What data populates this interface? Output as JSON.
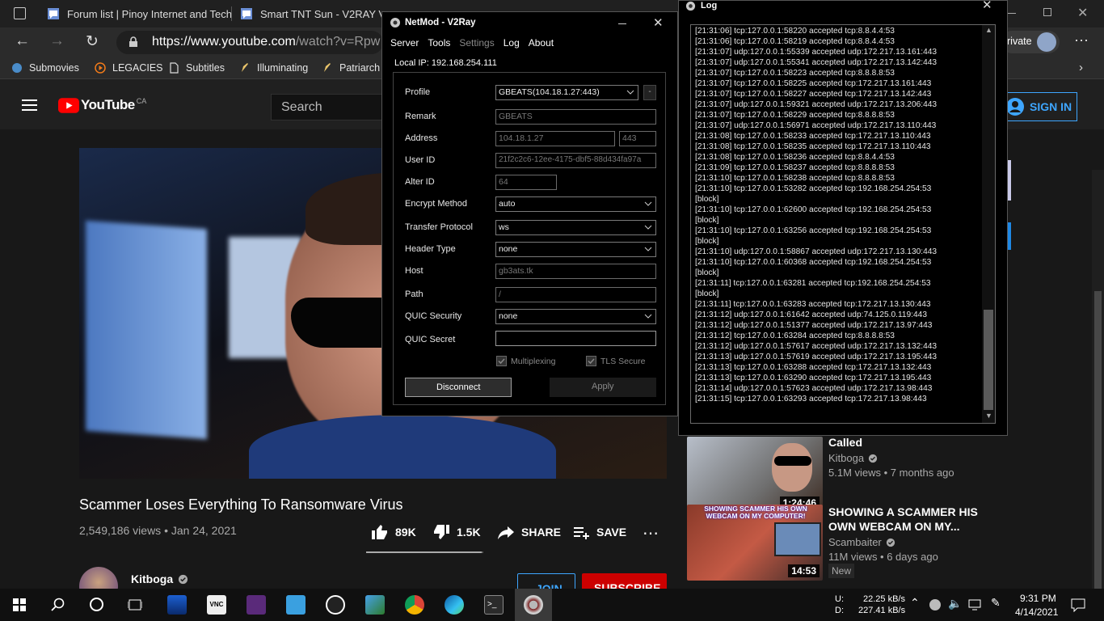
{
  "browser": {
    "tabs": [
      {
        "label": "Forum list | Pinoy Internet and Tech"
      },
      {
        "label": "Smart TNT Sun - V2RAY VMESS"
      }
    ],
    "url_prefix": "https://www.youtube.com",
    "url_rest": "/watch?v=Rpw",
    "profile_label": "rivate",
    "bookmarks": [
      {
        "label": "Submovies"
      },
      {
        "label": "LEGACIES"
      },
      {
        "label": "Subtitles"
      },
      {
        "label": "Illuminating"
      },
      {
        "label": "Patriarch"
      }
    ]
  },
  "youtube": {
    "logo_text": "YouTube",
    "logo_region": "CA",
    "search_placeholder": "Search",
    "sign_in": "SIGN IN",
    "video_title": "Scammer Loses Everything To Ransomware Virus",
    "views_date": "2,549,186 views • Jan 24, 2021",
    "likes": "89K",
    "dislikes": "1.5K",
    "share": "SHARE",
    "save": "SAVE",
    "like_ratio": 0.983,
    "channel": "Kitboga",
    "join": "JOIN",
    "subscribe": "SUBSCRIBE",
    "recommended": [
      {
        "title": "Called",
        "channel": "Kitboga",
        "meta": "5.1M views • 7 months ago",
        "duration": "1:24:46",
        "badge": ""
      },
      {
        "title": "SHOWING A SCAMMER HIS OWN WEBCAM ON MY...",
        "channel": "Scambaiter",
        "meta": "11M views • 6 days ago",
        "duration": "14:53",
        "badge": "New",
        "thumb_text": "SHOWING SCAMMER HIS OWN WEBCAM ON MY COMPUTER!"
      }
    ]
  },
  "netmod": {
    "title": "NetMod - V2Ray",
    "menu": [
      "Server",
      "Tools",
      "Settings",
      "Log",
      "About"
    ],
    "local_ip": "Local IP: 192.168.254.111",
    "labels": {
      "profile": "Profile",
      "remark": "Remark",
      "address": "Address",
      "user_id": "User ID",
      "alter_id": "Alter ID",
      "encrypt": "Encrypt Method",
      "transfer": "Transfer Protocol",
      "header": "Header Type",
      "host": "Host",
      "path": "Path",
      "quic_sec": "QUIC Security",
      "quic_secret": "QUIC Secret"
    },
    "values": {
      "profile": "GBEATS(104.18.1.27:443)",
      "profile_btn": "-",
      "remark": "GBEATS",
      "address": "104.18.1.27",
      "port": "443",
      "user_id": "21f2c2c6-12ee-4175-dbf5-88d434fa97a",
      "alter_id": "64",
      "encrypt": "auto",
      "transfer": "ws",
      "header": "none",
      "host": "gb3ats.tk",
      "path": "/",
      "quic_sec": "none",
      "quic_secret": ""
    },
    "multiplexing": "Multiplexing",
    "tls": "TLS Secure",
    "disconnect": "Disconnect",
    "apply": "Apply"
  },
  "log": {
    "title": "Log",
    "lines": [
      "[21:31:06]  tcp:127.0.0.1:58220 accepted tcp:8.8.4.4:53",
      "[21:31:06]  tcp:127.0.0.1:58219 accepted tcp:8.8.4.4:53",
      "[21:31:07]  udp:127.0.0.1:55339 accepted udp:172.217.13.161:443",
      "[21:31:07]  udp:127.0.0.1:55341 accepted udp:172.217.13.142:443",
      "[21:31:07]  tcp:127.0.0.1:58223 accepted tcp:8.8.8.8:53",
      "[21:31:07]  tcp:127.0.0.1:58225 accepted tcp:172.217.13.161:443",
      "[21:31:07]  tcp:127.0.0.1:58227 accepted tcp:172.217.13.142:443",
      "[21:31:07]  udp:127.0.0.1:59321 accepted udp:172.217.13.206:443",
      "[21:31:07]  tcp:127.0.0.1:58229 accepted tcp:8.8.8.8:53",
      "[21:31:07]  udp:127.0.0.1:56971 accepted udp:172.217.13.110:443",
      "[21:31:08]  tcp:127.0.0.1:58233 accepted tcp:172.217.13.110:443",
      "[21:31:08]  tcp:127.0.0.1:58235 accepted tcp:172.217.13.110:443",
      "[21:31:08]  tcp:127.0.0.1:58236 accepted tcp:8.8.4.4:53",
      "[21:31:09]  tcp:127.0.0.1:58237 accepted tcp:8.8.8.8:53",
      "[21:31:10]  tcp:127.0.0.1:58238 accepted tcp:8.8.8.8:53",
      "[21:31:10]  tcp:127.0.0.1:53282 accepted tcp:192.168.254.254:53",
      "[block]",
      "[21:31:10]  tcp:127.0.0.1:62600 accepted tcp:192.168.254.254:53",
      "[block]",
      "[21:31:10]  tcp:127.0.0.1:63256 accepted tcp:192.168.254.254:53",
      "[block]",
      "[21:31:10]  udp:127.0.0.1:58867 accepted udp:172.217.13.130:443",
      "[21:31:10]  tcp:127.0.0.1:60368 accepted tcp:192.168.254.254:53",
      "[block]",
      "[21:31:11]  tcp:127.0.0.1:63281 accepted tcp:192.168.254.254:53",
      "[block]",
      "[21:31:11]  tcp:127.0.0.1:63283 accepted tcp:172.217.13.130:443",
      "[21:31:12]  udp:127.0.0.1:61642 accepted udp:74.125.0.119:443",
      "[21:31:12]  udp:127.0.0.1:51377 accepted udp:172.217.13.97:443",
      "[21:31:12]  tcp:127.0.0.1:63284 accepted tcp:8.8.8.8:53",
      "[21:31:12]  udp:127.0.0.1:57617 accepted udp:172.217.13.132:443",
      "[21:31:13]  udp:127.0.0.1:57619 accepted udp:172.217.13.195:443",
      "[21:31:13]  tcp:127.0.0.1:63288 accepted tcp:172.217.13.132:443",
      "[21:31:13]  tcp:127.0.0.1:63290 accepted tcp:172.217.13.195:443",
      "[21:31:14]  udp:127.0.0.1:57623 accepted udp:172.217.13.98:443",
      "[21:31:15]  tcp:127.0.0.1:63293 accepted tcp:172.217.13.98:443"
    ]
  },
  "taskbar": {
    "net_up_label": "U:",
    "net_down_label": "D:",
    "net_up": "22.25 kB/s",
    "net_down": "227.41 kB/s",
    "time": "9:31 PM",
    "date": "4/14/2021"
  },
  "colors": {
    "yt_red": "#ff0000",
    "link_blue": "#3ea6ff",
    "accent": "#0078d7"
  }
}
